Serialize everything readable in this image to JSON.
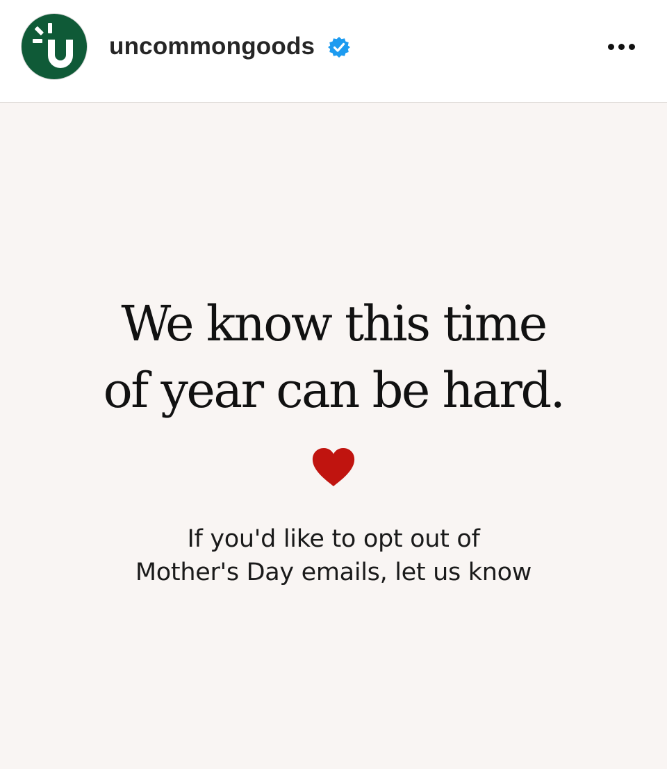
{
  "account": {
    "username": "uncommongoods",
    "avatar_icon": "uncommongoods-logo-icon",
    "verified_icon": "verified-badge-icon",
    "more_icon": "more-options-icon"
  },
  "post": {
    "headline_line1": "We know this time",
    "headline_line2": "of year can be hard.",
    "heart_icon": "heart-icon",
    "body_line1": "If you'd like to opt out of",
    "body_line2": "Mother's Day emails, let us know"
  },
  "colors": {
    "avatar_bg": "#0f5a37",
    "verified_badge": "#1d9bf0",
    "heart": "#c0140f",
    "post_bg": "#f9f5f3"
  }
}
